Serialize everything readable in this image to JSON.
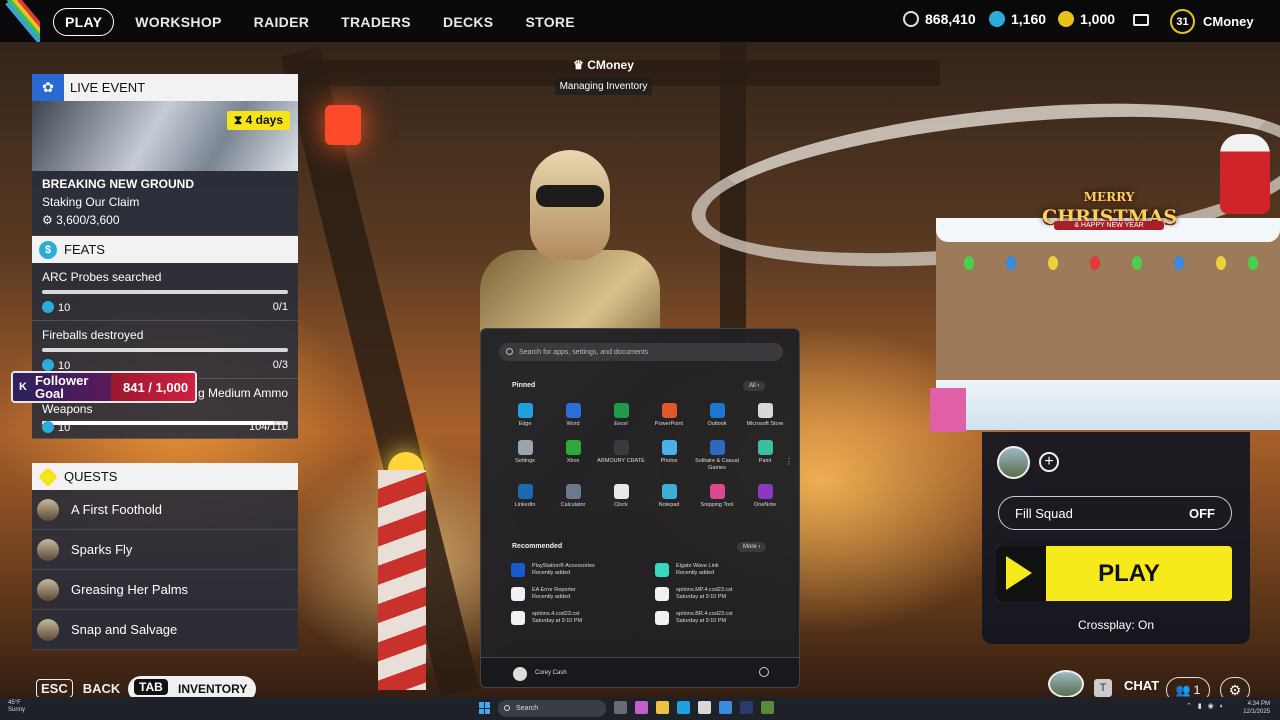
{
  "nav": {
    "items": [
      "PLAY",
      "WORKSHOP",
      "RAIDER",
      "TRADERS",
      "DECKS",
      "STORE"
    ],
    "active": "PLAY"
  },
  "currencies": [
    {
      "icon": "coins-icon",
      "value": "868,410",
      "color": "#e0e0e0"
    },
    {
      "icon": "raider-token-icon",
      "value": "1,160",
      "color": "#2aaed8"
    },
    {
      "icon": "cred-icon",
      "value": "1,000",
      "color": "#e6c21a"
    }
  ],
  "profile": {
    "level": "31",
    "username": "CMoney"
  },
  "live_event": {
    "header": "LIVE EVENT",
    "timer": "4 days",
    "title": "BREAKING NEW GROUND",
    "subtitle": "Staking Our Claim",
    "progress": "3,600/3,600"
  },
  "feats": {
    "header": "FEATS",
    "items": [
      {
        "name": "ARC Probes searched",
        "reward": "10",
        "progress": "0/1",
        "fraction": 0
      },
      {
        "name": "Fireballs destroyed",
        "reward": "10",
        "progress": "0/3",
        "fraction": 0
      },
      {
        "name": "g Medium Ammo",
        "name2": "Weapons",
        "reward": "10",
        "progress": "104/110",
        "fraction": 0.945
      }
    ]
  },
  "quests": {
    "header": "QUESTS",
    "items": [
      "A First Foothold",
      "Sparks Fly",
      "Greasing Her Palms",
      "Snap and Salvage"
    ]
  },
  "follower_goal": {
    "label_line1": "Follower",
    "label_line2": "Goal",
    "value": "841 / 1,000"
  },
  "player_tag": {
    "name": "CMoney",
    "status": "Managing Inventory"
  },
  "start_menu": {
    "search_placeholder": "Search for apps, settings, and documents",
    "pinned_label": "Pinned",
    "all_label": "All",
    "pinned_apps": [
      {
        "name": "Edge",
        "color": "#1fa0e0"
      },
      {
        "name": "Word",
        "color": "#2b6fd6"
      },
      {
        "name": "Excel",
        "color": "#1f9a4a"
      },
      {
        "name": "PowerPoint",
        "color": "#e0582a"
      },
      {
        "name": "Outlook",
        "color": "#1a78d0"
      },
      {
        "name": "Microsoft Store",
        "color": "#d8d8d8"
      },
      {
        "name": "Settings",
        "color": "#9aa4b0"
      },
      {
        "name": "Xbox",
        "color": "#2fa83a"
      },
      {
        "name": "ARMOURY CRATE",
        "color": "#3a3a3a"
      },
      {
        "name": "Photos",
        "color": "#4ab0e8"
      },
      {
        "name": "Solitaire & Casual Games",
        "color": "#2a6ac0"
      },
      {
        "name": "Paint",
        "color": "#3ac0a0"
      },
      {
        "name": "LinkedIn",
        "color": "#1a6ab0"
      },
      {
        "name": "Calculator",
        "color": "#6a7a8a"
      },
      {
        "name": "Clock",
        "color": "#e8e8e8"
      },
      {
        "name": "Notepad",
        "color": "#3ab0d8"
      },
      {
        "name": "Snipping Tool",
        "color": "#d84a8a"
      },
      {
        "name": "OneNote",
        "color": "#8a3ac0"
      }
    ],
    "recommended_label": "Recommended",
    "more_label": "More",
    "recommended": [
      {
        "name": "PlayStation® Accessories",
        "detail": "Recently added",
        "color": "#1a5ad0"
      },
      {
        "name": "Elgato Wave Link",
        "detail": "Recently added",
        "color": "#3ad8c0"
      },
      {
        "name": "EA Error Reporter",
        "detail": "Recently added",
        "color": "#f0f0f0"
      },
      {
        "name": "options.MP.4.cod23.cst",
        "detail": "Saturday at 9:10 PM",
        "color": "#f0f0f0"
      },
      {
        "name": "options.4.cod23.cst",
        "detail": "Saturday at 9:10 PM",
        "color": "#f0f0f0"
      },
      {
        "name": "options.BR.4.cod23.cst",
        "detail": "Saturday at 9:10 PM",
        "color": "#f0f0f0"
      }
    ],
    "user": "Corey Cash"
  },
  "xmas": {
    "title_line1": "MERRY",
    "title_line2": "CHRISTMAS",
    "subtitle": "& HAPPY NEW YEAR"
  },
  "squad": {
    "fill_label": "Fill Squad",
    "fill_value": "OFF",
    "play_label": "PLAY",
    "crossplay": "Crossplay: On"
  },
  "bottom": {
    "back_key": "ESC",
    "back_label": "BACK",
    "inv_key": "TAB",
    "inv_label": "INVENTORY",
    "chat_key": "T",
    "chat_label": "CHAT",
    "friends_count": "1"
  },
  "taskbar": {
    "weather_temp": "45°F",
    "weather_desc": "Sunny",
    "search_label": "Search",
    "time": "4:34 PM",
    "date": "12/1/2025"
  }
}
